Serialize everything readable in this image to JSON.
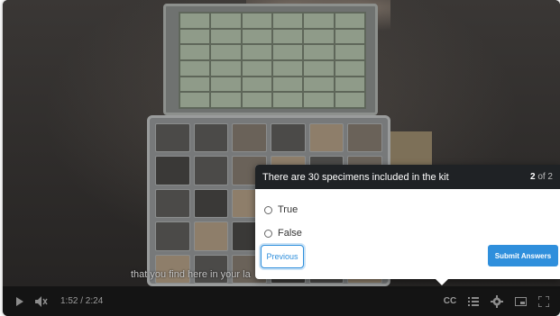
{
  "video": {
    "caption": "that you find here in your la",
    "current_time": "1:52",
    "duration": "2:24",
    "time_display": "1:52 / 2:24"
  },
  "controls": {
    "play_icon": "play-icon",
    "volume_icon": "volume-muted-icon",
    "cc_label": "CC",
    "chapters_icon": "chapters-icon",
    "settings_icon": "gear-icon",
    "pip_icon": "picture-in-picture-icon",
    "fullscreen_icon": "fullscreen-icon"
  },
  "quiz": {
    "question": "There are 30 specimens included in the kit",
    "progress_current": "2",
    "progress_of": "of 2",
    "options": [
      "True",
      "False"
    ],
    "previous_label": "Previous",
    "submit_label": "Submit Answers"
  },
  "colors": {
    "accent": "#2f8fdc",
    "header_bg": "#1f2225",
    "controls_bg": "#141414"
  }
}
